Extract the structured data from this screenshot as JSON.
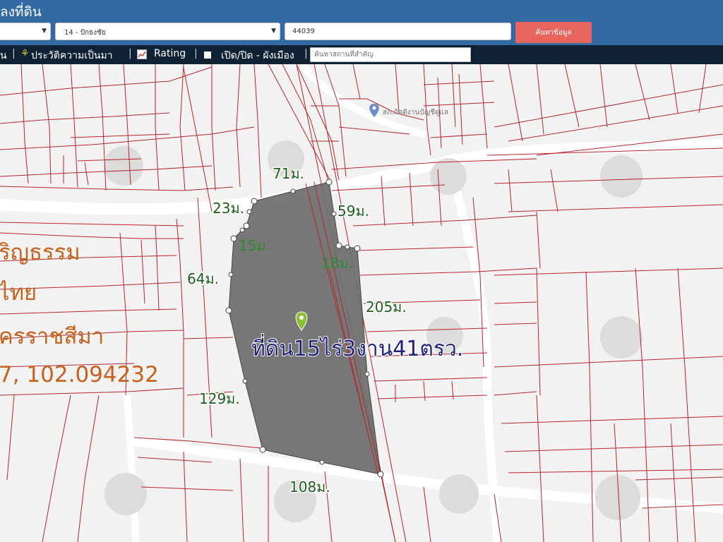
{
  "header": {
    "title": "ลงที่ดิน",
    "province_select": "",
    "district_select": "14 - ปักธงชัย",
    "parcel_number": "44039",
    "search_button": "ค้นหาข้อมูล"
  },
  "toolbar": {
    "item_partial": "น",
    "history_label": "ประวัติความเป็นมา",
    "rating_label": "Rating",
    "toggle_label": "เปิด/ปิด - ผังเมือง",
    "landmark_placeholder": "ค้นหาสถานที่สำคัญ"
  },
  "map": {
    "poi_label": "สภ.กิตติงานบัญชีดูแล",
    "area_label": "ที่ดิน15ไร่3งาน41ตรว.",
    "overlay_lines": [
      "ริญธรรม",
      "ไทย",
      "ครราชสีมา",
      "7, 102.094232"
    ],
    "dimensions": [
      "71ม.",
      "23ม.",
      "59ม.",
      "15ม.",
      "18ม.",
      "64ม.",
      "205ม.",
      "129ม.",
      "108ม."
    ]
  },
  "colors": {
    "header": "#336aa3",
    "toolbar": "#0f2233",
    "search_button": "#e8655d",
    "parcel_fill": "#6d6d6d",
    "boundary": "#b3262c",
    "dimension_text": "#1d5c1d",
    "area_text": "#23237a",
    "overlay_text": "#c4621e"
  }
}
